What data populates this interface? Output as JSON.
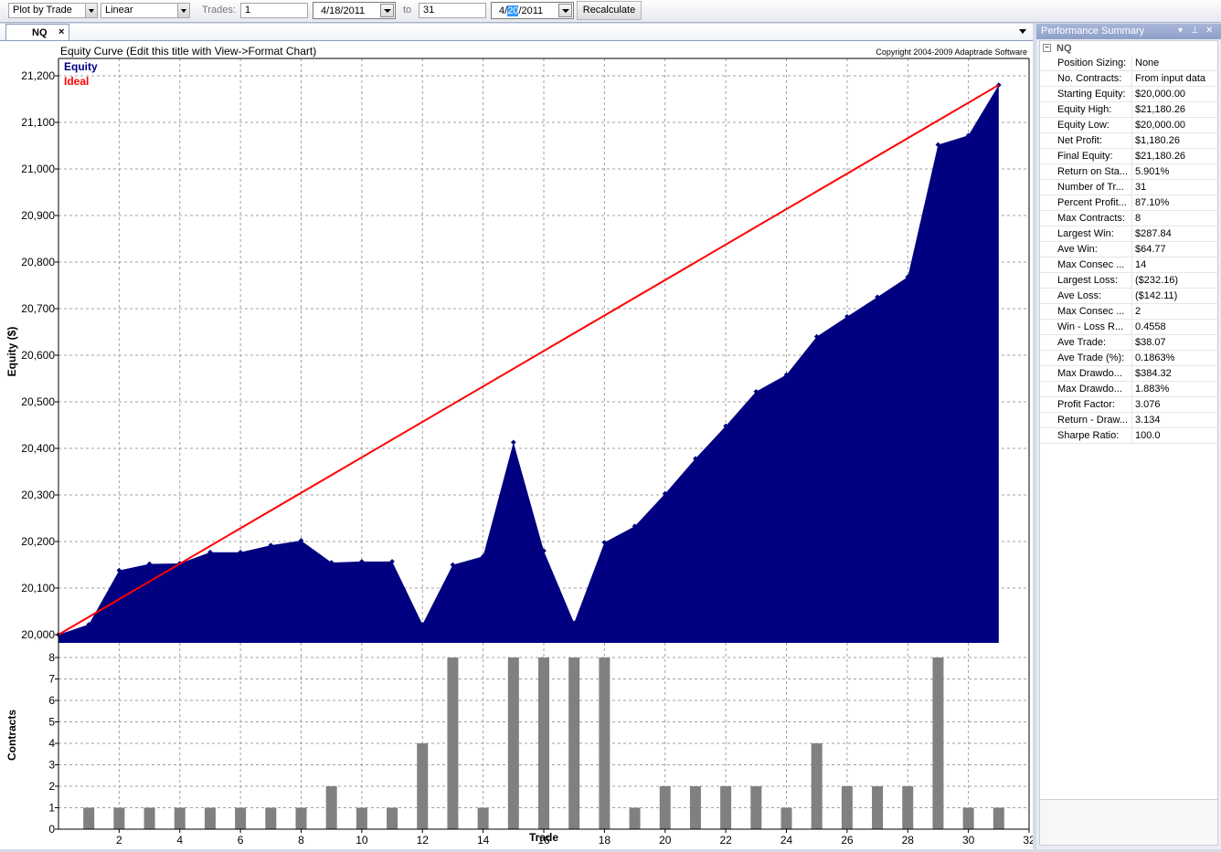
{
  "toolbar": {
    "plot_mode": "Plot by Trade",
    "scale": "Linear",
    "trades_label": "Trades:",
    "trades_from": "1",
    "start_date": "4/18/2011",
    "to_label": "to",
    "trades_to": "31",
    "end_date_pre": "4/",
    "end_date_sel": "20",
    "end_date_post": "/2011",
    "recalc_label": "Recalculate"
  },
  "tab": {
    "label": "NQ",
    "close": "×"
  },
  "chart": {
    "title": "Equity Curve (Edit this title with View->Format Chart)",
    "copyright": "Copyright 2004-2009 Adaptrade Software",
    "legend": [
      {
        "label": "Equity",
        "color": "#000080"
      },
      {
        "label": "Ideal",
        "color": "#ff0000"
      }
    ],
    "equity_ylabel": "Equity ($)",
    "contracts_ylabel": "Contracts",
    "xlabel": "Trade",
    "equity_ticks": [
      "20,000",
      "20,100",
      "20,200",
      "20,300",
      "20,400",
      "20,500",
      "20,600",
      "20,700",
      "20,800",
      "20,900",
      "21,000",
      "21,100",
      "21,200"
    ],
    "contracts_ticks": [
      "0",
      "1",
      "2",
      "3",
      "4",
      "5",
      "6",
      "7",
      "8"
    ],
    "x_ticks": [
      "2",
      "4",
      "6",
      "8",
      "10",
      "12",
      "14",
      "16",
      "18",
      "20",
      "22",
      "24",
      "26",
      "28",
      "30",
      "32"
    ]
  },
  "chart_data": {
    "type": "area",
    "title": "Equity Curve (Edit this title with View->Format Chart)",
    "xlabel": "Trade",
    "ylabel": "Equity ($)",
    "xlim": [
      0,
      32
    ],
    "ylim": [
      19985,
      21200
    ],
    "grid": true,
    "legend_position": "top-left",
    "x": [
      0,
      1,
      2,
      3,
      4,
      5,
      6,
      7,
      8,
      9,
      10,
      11,
      12,
      13,
      14,
      15,
      16,
      17,
      18,
      19,
      20,
      21,
      22,
      23,
      24,
      25,
      26,
      27,
      28,
      29,
      30,
      31
    ],
    "series": [
      {
        "name": "Equity",
        "color": "#000080",
        "values": [
          20000,
          20022,
          20138,
          20152,
          20153,
          20177,
          20177,
          20192,
          20202,
          20155,
          20157,
          20157,
          20022,
          20150,
          20168,
          20413,
          20180,
          20025,
          20198,
          20233,
          20303,
          20378,
          20448,
          20522,
          20558,
          20640,
          20683,
          20725,
          20768,
          21052,
          21072,
          21180.26
        ]
      },
      {
        "name": "Ideal",
        "color": "#ff0000",
        "values": [
          20000,
          21180.26
        ],
        "x": [
          0,
          31
        ]
      }
    ],
    "contracts": {
      "ylabel": "Contracts",
      "ylim": [
        0,
        8.5
      ],
      "x": [
        1,
        2,
        3,
        4,
        5,
        6,
        7,
        8,
        9,
        10,
        11,
        12,
        13,
        14,
        15,
        16,
        17,
        18,
        19,
        20,
        21,
        22,
        23,
        24,
        25,
        26,
        27,
        28,
        29,
        30,
        31
      ],
      "values": [
        1,
        1,
        1,
        1,
        1,
        1,
        1,
        1,
        2,
        1,
        1,
        4,
        8,
        1,
        8,
        8,
        8,
        8,
        1,
        2,
        2,
        2,
        2,
        1,
        4,
        2,
        2,
        2,
        8,
        1,
        1
      ],
      "color": "#808080"
    }
  },
  "panel": {
    "title": "Performance Summary",
    "root": "NQ",
    "rows": [
      {
        "k": "Position Sizing:",
        "v": "None"
      },
      {
        "k": "No. Contracts:",
        "v": "From input data"
      },
      {
        "k": "Starting Equity:",
        "v": "$20,000.00"
      },
      {
        "k": "Equity High:",
        "v": "$21,180.26"
      },
      {
        "k": "Equity Low:",
        "v": "$20,000.00"
      },
      {
        "k": "Net Profit:",
        "v": "$1,180.26"
      },
      {
        "k": "Final Equity:",
        "v": "$21,180.26"
      },
      {
        "k": "Return on Sta...",
        "v": "5.901%"
      },
      {
        "k": "Number of Tr...",
        "v": "31"
      },
      {
        "k": "Percent Profit...",
        "v": "87.10%"
      },
      {
        "k": "Max Contracts:",
        "v": "8"
      },
      {
        "k": "Largest Win:",
        "v": "$287.84"
      },
      {
        "k": "Ave Win:",
        "v": "$64.77"
      },
      {
        "k": "Max Consec ...",
        "v": "14"
      },
      {
        "k": "Largest Loss:",
        "v": "($232.16)"
      },
      {
        "k": "Ave Loss:",
        "v": "($142.11)"
      },
      {
        "k": "Max Consec ...",
        "v": "2"
      },
      {
        "k": "Win - Loss R...",
        "v": "0.4558"
      },
      {
        "k": "Ave Trade:",
        "v": "$38.07"
      },
      {
        "k": "Ave Trade (%):",
        "v": "0.1863%"
      },
      {
        "k": "Max Drawdo...",
        "v": "$384.32"
      },
      {
        "k": "Max Drawdo...",
        "v": "1.883%"
      },
      {
        "k": "Profit Factor:",
        "v": "3.076"
      },
      {
        "k": "Return - Draw...",
        "v": "3.134"
      },
      {
        "k": "Sharpe Ratio:",
        "v": "100.0"
      }
    ]
  }
}
